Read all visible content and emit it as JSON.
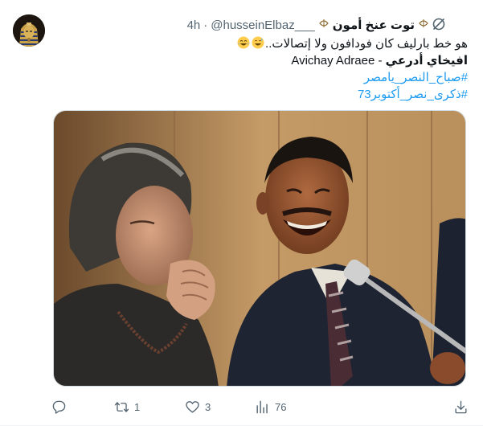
{
  "tweet": {
    "display_name": "توت عنخ أمون",
    "handle": "@husseinElbaz___",
    "separator": "·",
    "time": "4h",
    "text_line1": "هو خط بارليف كان فودافون ولا إتصالات..",
    "text_line2_bold": "افيخاي أدرعي",
    "text_line2_rest": "- Avichay Adraee",
    "hashtag1": "#صباح_النصر_يامصر",
    "hashtag2": "#ذكرى_نصر_أكتوبر73"
  },
  "actions": {
    "replies": "",
    "retweets": "1",
    "likes": "3",
    "views": "76"
  },
  "colors": {
    "link": "#1d9bf0",
    "secondary": "#536471",
    "text": "#0f1419",
    "border": "#cfd9de"
  },
  "icons": {
    "reply": "reply-icon",
    "retweet": "retweet-icon",
    "like": "heart-icon",
    "views": "views-icon",
    "download": "download-icon",
    "more": "grok-icon"
  }
}
